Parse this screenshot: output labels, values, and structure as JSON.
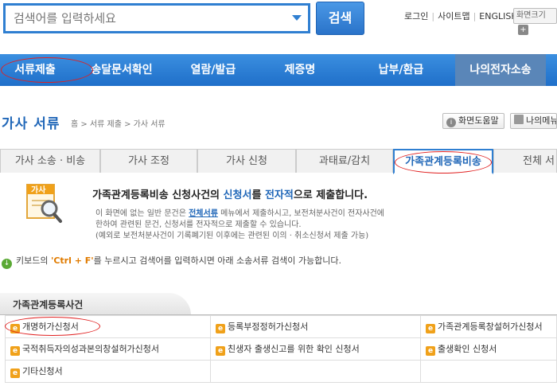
{
  "search": {
    "placeholder": "검색어를 입력하세요",
    "button_label": "검색"
  },
  "top_links": {
    "login": "로그인",
    "sitemap": "사이트맵",
    "english": "ENGLISH",
    "zoom_label": "화면크기",
    "zoom_plus": "+"
  },
  "main_nav": [
    {
      "label": "서류제출",
      "highlighted": true
    },
    {
      "label": "송달문서확인"
    },
    {
      "label": "열람/발급"
    },
    {
      "label": "제증명"
    },
    {
      "label": "납부/환급"
    },
    {
      "label": "나의전자소송",
      "selected": true
    }
  ],
  "page": {
    "title": "가사 서류",
    "breadcrumb": "홈 > 서류 제출 > 가사 서류",
    "help_button": "화면도움말",
    "my_menu_button": "나의메뉴"
  },
  "tabs": [
    {
      "label": "가사 소송 · 비송"
    },
    {
      "label": "가사 조정"
    },
    {
      "label": "가사 신청"
    },
    {
      "label": "과태료/감치"
    },
    {
      "label": "가족관계등록비송",
      "active": true
    },
    {
      "label": "전체 서"
    }
  ],
  "info": {
    "icon_label": "가사",
    "headline_pre": "가족관계등록비송 신청사건의 ",
    "headline_hl1": "신청서",
    "headline_mid": "를 ",
    "headline_hl2": "전자적",
    "headline_post": "으로 제출합니다.",
    "body1_pre": "이 화면에 없는 일반 문건은 ",
    "body1_link": "전체서류",
    "body1_post": " 메뉴에서 제출하시고, 보전처분사건이 전자사건에",
    "body2": "한하여 관련된 문건, 신청서를 전자적으로 제출할 수 있습니다.",
    "body3": "(예외로 보전처분사건이 기록폐기된 이후에는 관련된 이의 · 취소신청서 제출 가능)"
  },
  "hint": {
    "pre": "키보드의 ",
    "key": "'Ctrl + F'",
    "post": "를 누르시고 검색어를 입력하시면 아래 소송서류 검색이 가능합니다."
  },
  "section": {
    "title": "가족관계등록사건",
    "rows": [
      [
        "개명허가신청서",
        "등록부정정허가신청서",
        "가족관계등록창설허가신청서"
      ],
      [
        "국적취득자의성과본의창설허가신청서",
        "친생자 출생신고를 위한 확인 신청서",
        "출생확인 신청서"
      ],
      [
        "기타신청서",
        "",
        ""
      ]
    ]
  },
  "colors": {
    "accent": "#2f7fd1",
    "nav_bg": "#1f6fc9",
    "title": "#2067b8",
    "highlight_circle": "#e02020",
    "doc_icon": "#f0a11a"
  }
}
